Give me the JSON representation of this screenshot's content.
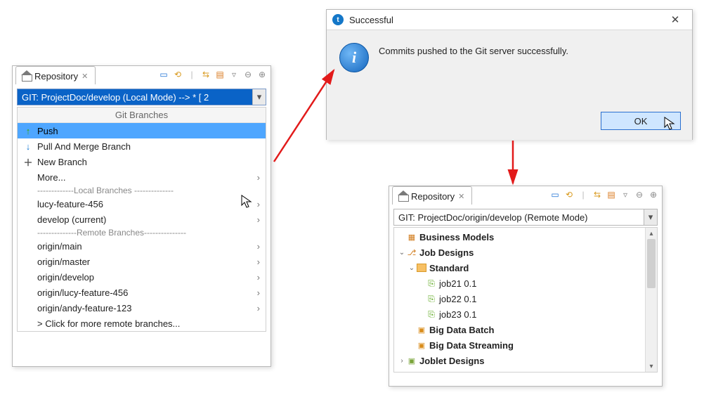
{
  "leftPanel": {
    "tabLabel": "Repository",
    "combo": "GIT: ProjectDoc/develop   (Local Mode)    -->  * [ 2",
    "branchesHeader": "Git Branches",
    "push": "Push",
    "pull": "Pull And Merge Branch",
    "newBranch": "New Branch",
    "more": "More...",
    "localSep": "-------------Local   Branches --------------",
    "local": [
      "lucy-feature-456",
      "develop (current)"
    ],
    "remoteSep": "--------------Remote Branches---------------",
    "remote": [
      "origin/main",
      "origin/master",
      "origin/develop",
      "origin/lucy-feature-456",
      "origin/andy-feature-123"
    ],
    "moreRemote": "> Click for more remote branches..."
  },
  "dialog": {
    "title": "Successful",
    "message": "Commits pushed to the Git server successfully.",
    "ok": "OK"
  },
  "rightPanel": {
    "tabLabel": "Repository",
    "combo": "GIT: ProjectDoc/origin/develop   (Remote Mode)",
    "tree": {
      "businessModels": "Business Models",
      "jobDesigns": "Job Designs",
      "standard": "Standard",
      "jobs": [
        "job21 0.1",
        "job22 0.1",
        "job23 0.1"
      ],
      "bigDataBatch": "Big Data Batch",
      "bigDataStreaming": "Big Data Streaming",
      "jobletDesigns": "Joblet Designs"
    }
  }
}
